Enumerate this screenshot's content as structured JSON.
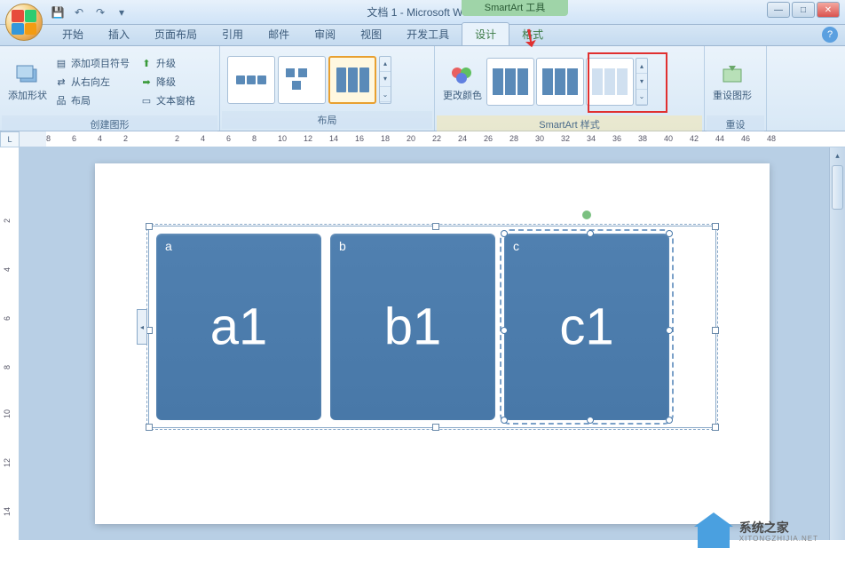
{
  "title": "文档 1 - Microsoft Word",
  "tool_context": "SmartArt 工具",
  "tabs": [
    "开始",
    "插入",
    "页面布局",
    "引用",
    "邮件",
    "审阅",
    "视图",
    "开发工具"
  ],
  "context_tabs": [
    "设计",
    "格式"
  ],
  "active_tab": "设计",
  "ribbon": {
    "create": {
      "label": "创建图形",
      "add_shape": "添加形状",
      "bullet": "添加项目符号",
      "rtl": "从右向左",
      "layout": "布局",
      "promote": "升级",
      "demote": "降级",
      "text_pane": "文本窗格"
    },
    "layouts": {
      "label": "布局"
    },
    "styles": {
      "label": "SmartArt 样式",
      "change_colors": "更改颜色"
    },
    "reset": {
      "label": "重设",
      "reset_graphic": "重设图形"
    }
  },
  "ruler_h": [
    8,
    6,
    4,
    2,
    "",
    2,
    4,
    6,
    8,
    10,
    12,
    14,
    16,
    18,
    20,
    22,
    24,
    26,
    28,
    30,
    32,
    34,
    36,
    38,
    40,
    42,
    44,
    46,
    48
  ],
  "ruler_v": [
    "",
    2,
    4,
    6,
    8,
    10,
    12,
    14
  ],
  "smartart": {
    "boxes": [
      {
        "label": "a",
        "main": "a1"
      },
      {
        "label": "b",
        "main": "b1"
      },
      {
        "label": "c",
        "main": "c1"
      }
    ],
    "selected": 2
  },
  "watermark": {
    "name": "系统之家",
    "sub": "XITONGZHIJIA.NET"
  }
}
